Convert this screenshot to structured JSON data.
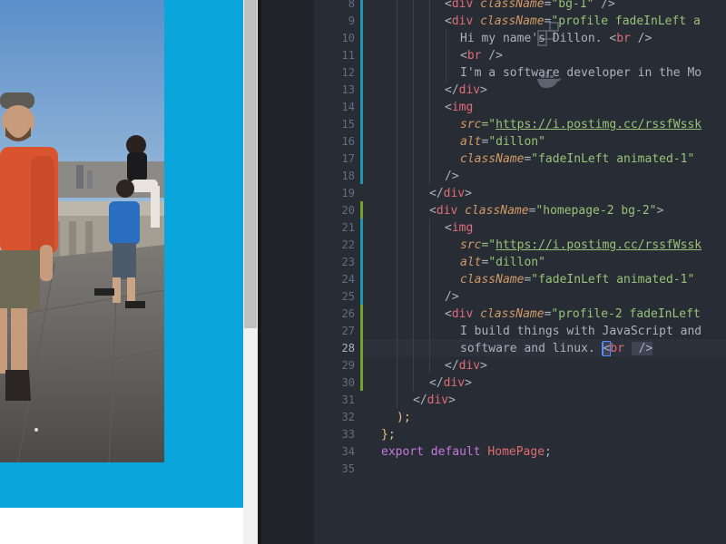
{
  "preview": {
    "photo_alt": "dillon",
    "colors": {
      "band": "#0aa5db",
      "page": "#ffffff"
    }
  },
  "editor": {
    "activity_icons": [
      "extensions-icon",
      "docker-icon"
    ],
    "line_numbers": [
      "8",
      "9",
      "10",
      "11",
      "12",
      "13",
      "14",
      "15",
      "16",
      "17",
      "18",
      "19",
      "20",
      "21",
      "22",
      "23",
      "24",
      "25",
      "26",
      "27",
      "28",
      "29",
      "30",
      "31",
      "32",
      "33",
      "34",
      "35"
    ],
    "active_line": "28",
    "lines": {
      "l8": {
        "p1": "<",
        "tag": "div",
        "attr": "className",
        "eq": "=",
        "str": "\"bg-1\"",
        "end": " />"
      },
      "l9": {
        "p1": "<",
        "tag": "div",
        "attr": "className",
        "eq": "=",
        "str": "\"profile fadeInLeft a"
      },
      "l10": {
        "text": "Hi my name's Dillon. ",
        "p1": "<",
        "tag": "br",
        "end": " />"
      },
      "l11": {
        "p1": "<",
        "tag": "br",
        "end": " />"
      },
      "l12": {
        "text": "I'm a software developer in the Mo"
      },
      "l13": {
        "p1": "</",
        "tag": "div",
        "end": ">"
      },
      "l14": {
        "p1": "<",
        "tag": "img"
      },
      "l15": {
        "attr": "src",
        "eq": "=\"",
        "url": "https://i.postimg.cc/rssfWssk"
      },
      "l16": {
        "attr": "alt",
        "eq": "=",
        "str": "\"dillon\""
      },
      "l17": {
        "attr": "className",
        "eq": "=",
        "str": "\"fadeInLeft animated-1\""
      },
      "l18": {
        "end": "/>"
      },
      "l19": {
        "p1": "</",
        "tag": "div",
        "end": ">"
      },
      "l20": {
        "p1": "<",
        "tag": "div",
        "attr": "className",
        "eq": "=",
        "str": "\"homepage-2 bg-2\"",
        "end": ">"
      },
      "l21": {
        "p1": "<",
        "tag": "img"
      },
      "l22": {
        "attr": "src",
        "eq": "=\"",
        "url": "https://i.postimg.cc/rssfWssk"
      },
      "l23": {
        "attr": "alt",
        "eq": "=",
        "str": "\"dillon\""
      },
      "l24": {
        "attr": "className",
        "eq": "=",
        "str": "\"fadeInLeft animated-1\""
      },
      "l25": {
        "end": "/>"
      },
      "l26": {
        "p1": "<",
        "tag": "div",
        "attr": "className",
        "eq": "=",
        "str": "\"profile-2 fadeInLeft"
      },
      "l27": {
        "text": "I build things with JavaScript and"
      },
      "l28": {
        "text": "software and linux. ",
        "p1": "<",
        "tag": "br",
        "end": " />"
      },
      "l29": {
        "p1": "</",
        "tag": "div",
        "end": ">"
      },
      "l30": {
        "p1": "</",
        "tag": "div",
        "end": ">"
      },
      "l31": {
        "p1": "</",
        "tag": "div",
        "end": ">"
      },
      "l32": {
        "text": ");"
      },
      "l33": {
        "text": "};"
      },
      "l34": {
        "kw": "export",
        "kw2": "default",
        "id": "HomePage",
        "end": ";"
      },
      "l35": {
        "text": ""
      }
    },
    "colors": {
      "background": "#282c34",
      "tag": "#e06c75",
      "attr": "#d19a66",
      "string": "#98c379",
      "keyword": "#c678dd",
      "git_modified": "#1f94b3",
      "git_added": "#73a32c"
    }
  }
}
